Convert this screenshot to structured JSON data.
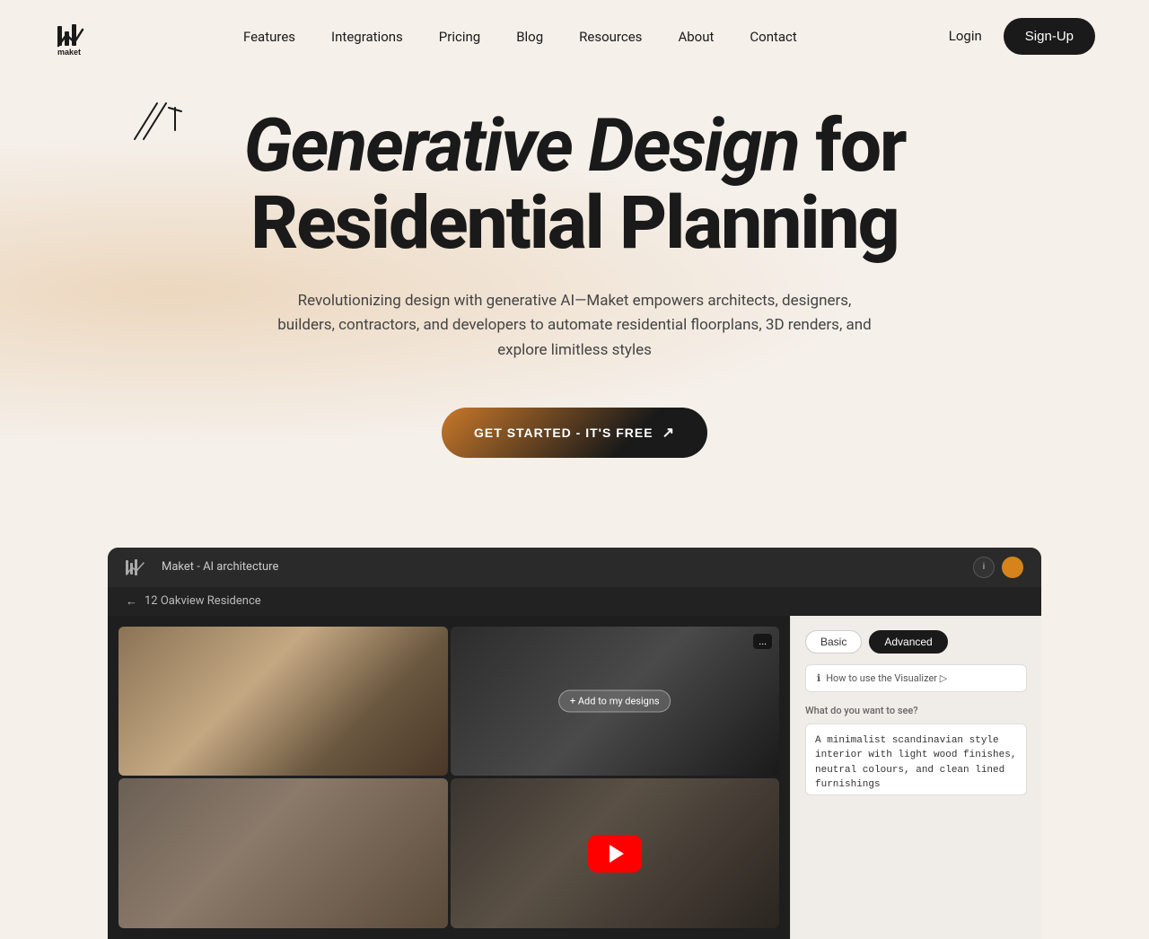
{
  "brand": {
    "name": "maket",
    "logo_alt": "Maket logo"
  },
  "nav": {
    "links": [
      {
        "label": "Features",
        "id": "features"
      },
      {
        "label": "Integrations",
        "id": "integrations"
      },
      {
        "label": "Pricing",
        "id": "pricing"
      },
      {
        "label": "Blog",
        "id": "blog"
      },
      {
        "label": "Resources",
        "id": "resources"
      },
      {
        "label": "About",
        "id": "about"
      },
      {
        "label": "Contact",
        "id": "contact"
      }
    ],
    "login_label": "Login",
    "signup_label": "Sign-Up"
  },
  "hero": {
    "title_italic": "Generative Design",
    "title_regular": " for\nResidential Planning",
    "subtitle": "Revolutionizing design with generative AI—Maket empowers architects, designers, builders, contractors, and developers to automate residential floorplans, 3D renders, and explore limitless styles",
    "cta_label": "GET STARTED - IT'S FREE",
    "cta_arrow": "↗"
  },
  "app_preview": {
    "titlebar": {
      "title": "Maket - AI architecture",
      "btn1": "i",
      "btn2": ""
    },
    "breadcrumb": {
      "back": "←",
      "path": "12 Oakview Residence"
    },
    "sidebar": {
      "tab_basic": "Basic",
      "tab_advanced": "Advanced",
      "how_to": "How to use the Visualizer ▷",
      "prompt_label": "What do you want to see?",
      "prompt_value": "A minimalist scandinavian style interior with light wood finishes, neutral colours, and clean lined furnishings"
    },
    "image_overlay": "...",
    "add_btn": "+ Add to my designs",
    "youtube_label": "YouTube play button"
  },
  "colors": {
    "background": "#f5f0ea",
    "dark": "#1a1a1a",
    "accent_orange": "#c8782a",
    "nav_bg": "#f5f0ea"
  }
}
